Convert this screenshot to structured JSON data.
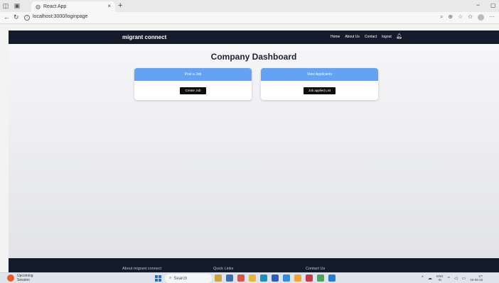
{
  "browser": {
    "tab_title": "React App",
    "tab_close": "×",
    "new_tab": "+",
    "url": "localhost:3000/loginpage",
    "minimize": "−",
    "maximize": "▢"
  },
  "navbar": {
    "brand": "migrant connect",
    "links": [
      "Home",
      "About Us",
      "Contact",
      "logout"
    ]
  },
  "main": {
    "title": "Company Dashboard",
    "cards": [
      {
        "header": "Post a Job",
        "button": "Create Job"
      },
      {
        "header": "View Applicants",
        "button": "Job applied List"
      }
    ]
  },
  "footer": {
    "columns": [
      "About migrant connect",
      "Quick Links",
      "Contact Us"
    ]
  },
  "taskbar": {
    "weather_line1": "Upcoming",
    "weather_line2": "Session",
    "search_placeholder": "Search",
    "lang_line1": "ENG",
    "lang_line2": "IN",
    "time": "17:",
    "date": "20-05-20"
  },
  "colors": {
    "navbar": "#141b2b",
    "card_header": "#63a3f3",
    "button": "#0d0d0d"
  }
}
